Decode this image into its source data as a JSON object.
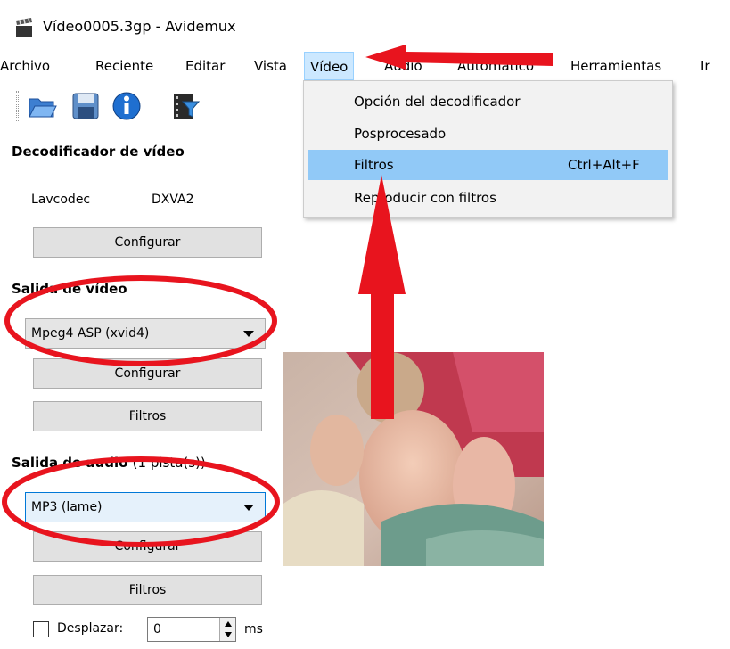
{
  "window": {
    "title": "Vídeo0005.3gp - Avidemux",
    "icon": "clapperboard-icon"
  },
  "menubar": {
    "items": [
      {
        "label": "Archivo"
      },
      {
        "label": "Reciente"
      },
      {
        "label": "Editar"
      },
      {
        "label": "Vista"
      },
      {
        "label": "Vídeo"
      },
      {
        "label": "Audio"
      },
      {
        "label": "Automático"
      },
      {
        "label": "Herramientas"
      },
      {
        "label": "Ir"
      }
    ]
  },
  "toolbar": {
    "icons": [
      "open-folder-icon",
      "save-floppy-icon",
      "info-icon",
      "filter-film-icon"
    ]
  },
  "video_menu": {
    "items": [
      {
        "label": "Opción del decodificador",
        "shortcut": ""
      },
      {
        "label": "Posprocesado",
        "shortcut": ""
      },
      {
        "label": "Filtros",
        "shortcut": "Ctrl+Alt+F",
        "highlighted": true
      },
      {
        "label": "Reproducir con filtros",
        "shortcut": ""
      }
    ]
  },
  "decoder": {
    "title": "Decodificador de vídeo",
    "codec": "Lavcodec",
    "hw": "DXVA2",
    "configure_label": "Configurar"
  },
  "video_output": {
    "title": "Salida de vídeo",
    "selected": "Mpeg4 ASP (xvid4)",
    "configure_label": "Configurar",
    "filters_label": "Filtros"
  },
  "audio_output": {
    "title": "Salida de audio",
    "tracks": "(1 pista(s))",
    "selected": "MP3 (lame)",
    "configure_label": "Configurar",
    "filters_label": "Filtros"
  },
  "offset": {
    "label": "Desplazar:",
    "value": "0",
    "unit": "ms",
    "checked": false
  },
  "annotation_color": "#e8141e"
}
